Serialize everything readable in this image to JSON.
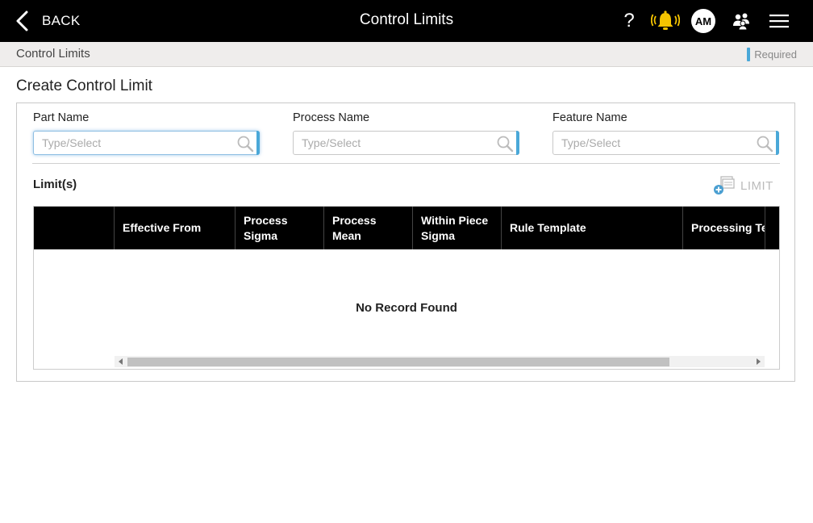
{
  "header": {
    "back_label": "BACK",
    "title": "Control Limits",
    "help_symbol": "?",
    "avatar_initials": "AM",
    "icons": [
      "back-chevron-icon",
      "help-icon",
      "alarm-bell-icon",
      "user-avatar",
      "users-icon",
      "hamburger-menu-icon"
    ],
    "alarm_color": "#f5c400"
  },
  "breadcrumb": {
    "current": "Control Limits",
    "required_label": "Required",
    "required_color": "#4aa8d8"
  },
  "form": {
    "title": "Create Control Limit",
    "fields": [
      {
        "label": "Part Name",
        "placeholder": "Type/Select",
        "value": ""
      },
      {
        "label": "Process Name",
        "placeholder": "Type/Select",
        "value": ""
      },
      {
        "label": "Feature Name",
        "placeholder": "Type/Select",
        "value": ""
      }
    ]
  },
  "limits": {
    "label": "Limit(s)",
    "add_label": "LIMIT",
    "columns": [
      {
        "label": ""
      },
      {
        "label": "Effective From"
      },
      {
        "label": "Process Sigma"
      },
      {
        "label": "Process Mean"
      },
      {
        "label": "Within Piece Sigma"
      },
      {
        "label": "Rule Template"
      },
      {
        "label": "Processing Template"
      }
    ],
    "rows": [],
    "empty_message": "No Record Found"
  }
}
